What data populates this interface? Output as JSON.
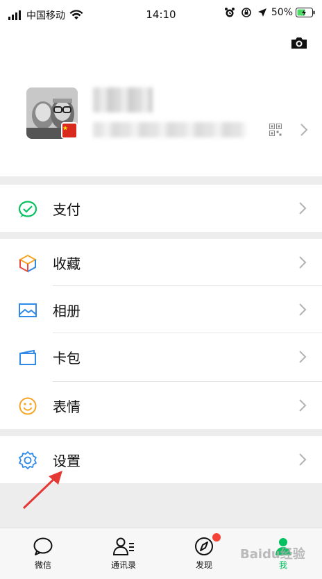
{
  "status_bar": {
    "carrier": "中国移动",
    "time": "14:10",
    "battery": "50%"
  },
  "menu": {
    "pay": "支付",
    "favorites": "收藏",
    "album": "相册",
    "cards": "卡包",
    "stickers": "表情",
    "settings": "设置"
  },
  "tabbar": {
    "chats": "微信",
    "contacts": "通讯录",
    "discover": "发现",
    "me": "我"
  },
  "watermark": "Baidu经验",
  "colors": {
    "accent": "#07c160",
    "badge": "#f44336",
    "arrow": "#e53935"
  }
}
